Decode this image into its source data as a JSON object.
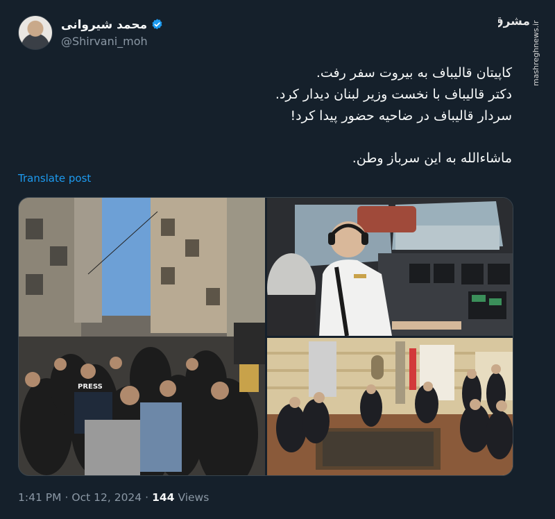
{
  "author": {
    "display_name": "محمد شیروانی",
    "handle": "@Shirvani_moh"
  },
  "icons": {
    "avatar": "profile-photo",
    "verified": "verified-badge-icon",
    "watermark": "mashregh-logo"
  },
  "watermark": {
    "logo_text": "مشرق",
    "site_text": "mashreghnews.ir"
  },
  "tweet": {
    "lines": [
      "کاپیتان قالیباف به بیروت سفر رفت.",
      "دکتر قالیباف با نخست وزیر لبنان دیدار کرد.",
      "سردار قالیباف در ضاحیه حضور پیدا کرد!",
      "ماشاءالله به این سرباز وطن."
    ],
    "translate_label": "Translate post"
  },
  "media": {
    "images": [
      "crowd-street-beirut",
      "pilot-cockpit",
      "meeting-room"
    ],
    "press_vest_text": "PRESS"
  },
  "meta": {
    "time": "1:41 PM",
    "separator": "·",
    "date": "Oct 12, 2024",
    "views_count": "144",
    "views_label": "Views"
  },
  "colors": {
    "background": "#15202b",
    "text": "#f7f9f9",
    "secondary": "#8b98a5",
    "link": "#1d9bf0",
    "verified": "#1d9bf0"
  }
}
